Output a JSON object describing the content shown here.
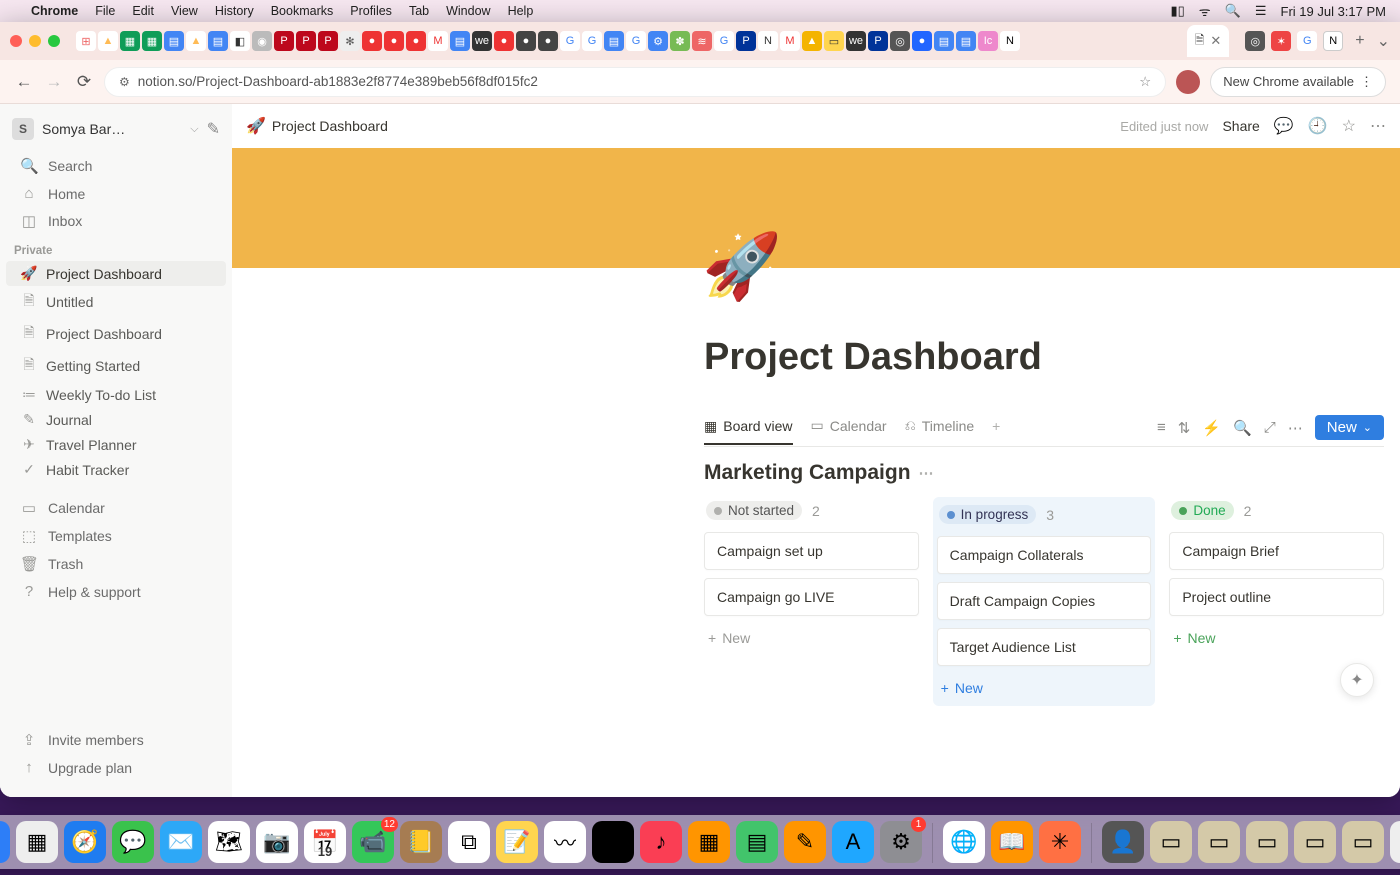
{
  "menubar": {
    "app": "Chrome",
    "items": [
      "File",
      "Edit",
      "View",
      "History",
      "Bookmarks",
      "Profiles",
      "Tab",
      "Window",
      "Help"
    ],
    "clock": "Fri 19 Jul  3:17 PM"
  },
  "browser": {
    "url_display": "notion.so/Project-Dashboard-ab1883e2f8774e389beb56f8df015fc2",
    "new_chrome": "New Chrome available",
    "active_tab_close": "✕",
    "new_tab_plus": "+",
    "overflow": "⌄"
  },
  "favicons": [
    {
      "bg": "#fff",
      "txt": "⊞",
      "fg": "#e66"
    },
    {
      "bg": "#fff",
      "txt": "▲",
      "fg": "#fb5"
    },
    {
      "bg": "#0f9d58",
      "txt": "▦",
      "fg": "#fff"
    },
    {
      "bg": "#0f9d58",
      "txt": "▦",
      "fg": "#fff"
    },
    {
      "bg": "#4285f4",
      "txt": "▤",
      "fg": "#fff"
    },
    {
      "bg": "#fff",
      "txt": "▲",
      "fg": "#fb5"
    },
    {
      "bg": "#4285f4",
      "txt": "▤",
      "fg": "#fff"
    },
    {
      "bg": "#fff",
      "txt": "◧",
      "fg": "#333"
    },
    {
      "bg": "#bbb",
      "txt": "◉",
      "fg": "#fff"
    },
    {
      "bg": "#bd081c",
      "txt": "P",
      "fg": "#fff"
    },
    {
      "bg": "#bd081c",
      "txt": "P",
      "fg": "#fff"
    },
    {
      "bg": "#bd081c",
      "txt": "P",
      "fg": "#fff"
    },
    {
      "bg": "#eee",
      "txt": "✻",
      "fg": "#555"
    },
    {
      "bg": "#e33",
      "txt": "●",
      "fg": "#fff"
    },
    {
      "bg": "#e33",
      "txt": "●",
      "fg": "#fff"
    },
    {
      "bg": "#e33",
      "txt": "●",
      "fg": "#fff"
    },
    {
      "bg": "#fff",
      "txt": "M",
      "fg": "#e33"
    },
    {
      "bg": "#4285f4",
      "txt": "▤",
      "fg": "#fff"
    },
    {
      "bg": "#333",
      "txt": "we",
      "fg": "#fff"
    },
    {
      "bg": "#e33",
      "txt": "●",
      "fg": "#fff"
    },
    {
      "bg": "#444",
      "txt": "●",
      "fg": "#fff"
    },
    {
      "bg": "#444",
      "txt": "●",
      "fg": "#fff"
    },
    {
      "bg": "#fff",
      "txt": "G",
      "fg": "#4285f4"
    },
    {
      "bg": "#fff",
      "txt": "G",
      "fg": "#4285f4"
    },
    {
      "bg": "#4285f4",
      "txt": "▤",
      "fg": "#fff"
    },
    {
      "bg": "#fff",
      "txt": "G",
      "fg": "#4285f4"
    },
    {
      "bg": "#4285f4",
      "txt": "⚙",
      "fg": "#fff"
    },
    {
      "bg": "#7b5",
      "txt": "✽",
      "fg": "#fff"
    },
    {
      "bg": "#e66",
      "txt": "≋",
      "fg": "#fff"
    },
    {
      "bg": "#fff",
      "txt": "G",
      "fg": "#4285f4"
    },
    {
      "bg": "#039",
      "txt": "P",
      "fg": "#fff"
    },
    {
      "bg": "#fff",
      "txt": "N",
      "fg": "#333"
    },
    {
      "bg": "#fff",
      "txt": "M",
      "fg": "#e33"
    },
    {
      "bg": "#f4b400",
      "txt": "▲",
      "fg": "#fff"
    },
    {
      "bg": "#ffd54f",
      "txt": "▭",
      "fg": "#333"
    },
    {
      "bg": "#333",
      "txt": "we",
      "fg": "#fff"
    },
    {
      "bg": "#039",
      "txt": "P",
      "fg": "#fff"
    },
    {
      "bg": "#555",
      "txt": "◎",
      "fg": "#fff"
    },
    {
      "bg": "#26f",
      "txt": "●",
      "fg": "#fff"
    },
    {
      "bg": "#4285f4",
      "txt": "▤",
      "fg": "#fff"
    },
    {
      "bg": "#4285f4",
      "txt": "▤",
      "fg": "#fff"
    },
    {
      "bg": "#e8c",
      "txt": "Ic",
      "fg": "#fff"
    },
    {
      "bg": "#fff",
      "txt": "N",
      "fg": "#000"
    }
  ],
  "workspace": {
    "initial": "S",
    "name": "Somya Bar…"
  },
  "sidebar": {
    "search": "Search",
    "home": "Home",
    "inbox": "Inbox",
    "private": "Private",
    "pages": [
      {
        "icon": "🚀",
        "label": "Project Dashboard",
        "active": true
      },
      {
        "icon": "🗎",
        "label": "Untitled"
      },
      {
        "icon": "🗎",
        "label": "Project Dashboard"
      },
      {
        "icon": "🗎",
        "label": "Getting Started"
      },
      {
        "icon": "≔",
        "label": "Weekly To-do List"
      },
      {
        "icon": "✎",
        "label": "Journal"
      },
      {
        "icon": "✈",
        "label": "Travel Planner"
      },
      {
        "icon": "✓",
        "label": "Habit Tracker"
      }
    ],
    "calendar": "Calendar",
    "templates": "Templates",
    "trash": "Trash",
    "help": "Help & support",
    "invite": "Invite members",
    "upgrade": "Upgrade plan"
  },
  "topbar": {
    "emoji": "🚀",
    "title": "Project Dashboard",
    "edited": "Edited just now",
    "share": "Share"
  },
  "page": {
    "emoji": "🚀",
    "title": "Project Dashboard"
  },
  "db": {
    "tabs": [
      {
        "icon": "▦",
        "label": "Board view",
        "active": true
      },
      {
        "icon": "▭",
        "label": "Calendar"
      },
      {
        "icon": "⎌",
        "label": "Timeline"
      }
    ],
    "new": "New",
    "title": "Marketing Campaign"
  },
  "board": {
    "columns": [
      {
        "status": "Not started",
        "pill": "grey",
        "count": 2,
        "cards": [
          "Campaign set up",
          "Campaign go LIVE"
        ],
        "add": "New",
        "addStyle": "grey"
      },
      {
        "status": "In progress",
        "pill": "blue",
        "count": 3,
        "cards": [
          "Campaign Collaterals",
          "Draft Campaign Copies",
          "Target Audience List"
        ],
        "add": "New",
        "addStyle": "blue",
        "highlight": true
      },
      {
        "status": "Done",
        "pill": "green",
        "count": 2,
        "cards": [
          "Campaign Brief",
          "Project outline"
        ],
        "add": "New",
        "addStyle": "green"
      }
    ]
  },
  "dock": [
    {
      "bg": "#2d7ef7",
      "e": "☺"
    },
    {
      "bg": "#eee",
      "e": "▦"
    },
    {
      "bg": "#1f7cf0",
      "e": "🧭"
    },
    {
      "bg": "#3ac24c",
      "e": "💬"
    },
    {
      "bg": "#2da8f7",
      "e": "✉️"
    },
    {
      "bg": "#fff",
      "e": "🗺"
    },
    {
      "bg": "#fff",
      "e": "📷"
    },
    {
      "bg": "#fff",
      "e": "📅",
      "sub": "19"
    },
    {
      "bg": "#34c759",
      "e": "📹",
      "badge": "12"
    },
    {
      "bg": "#a67c52",
      "e": "📒"
    },
    {
      "bg": "#fff",
      "e": "⧉"
    },
    {
      "bg": "#ffd54f",
      "e": "📝"
    },
    {
      "bg": "#fff",
      "e": "〰"
    },
    {
      "bg": "#000",
      "e": "tv"
    },
    {
      "bg": "#fa3e54",
      "e": "♪"
    },
    {
      "bg": "#ff9500",
      "e": "▦"
    },
    {
      "bg": "#42c46b",
      "e": "▤"
    },
    {
      "bg": "#ff9500",
      "e": "✎"
    },
    {
      "bg": "#1fa7ff",
      "e": "A"
    },
    {
      "bg": "#8e8e93",
      "e": "⚙",
      "badge": "1"
    }
  ],
  "dock2": [
    {
      "bg": "#fff",
      "e": "🌐"
    },
    {
      "bg": "#ff9500",
      "e": "📖"
    },
    {
      "bg": "#ff7043",
      "e": "✳"
    }
  ],
  "dock3": [
    {
      "bg": "#555",
      "e": "👤"
    },
    {
      "bg": "#d4c9a8",
      "e": "▭"
    },
    {
      "bg": "#d4c9a8",
      "e": "▭"
    },
    {
      "bg": "#d4c9a8",
      "e": "▭"
    },
    {
      "bg": "#d4c9a8",
      "e": "▭"
    },
    {
      "bg": "#d4c9a8",
      "e": "▭"
    },
    {
      "bg": "#eee",
      "e": "🗑"
    }
  ]
}
